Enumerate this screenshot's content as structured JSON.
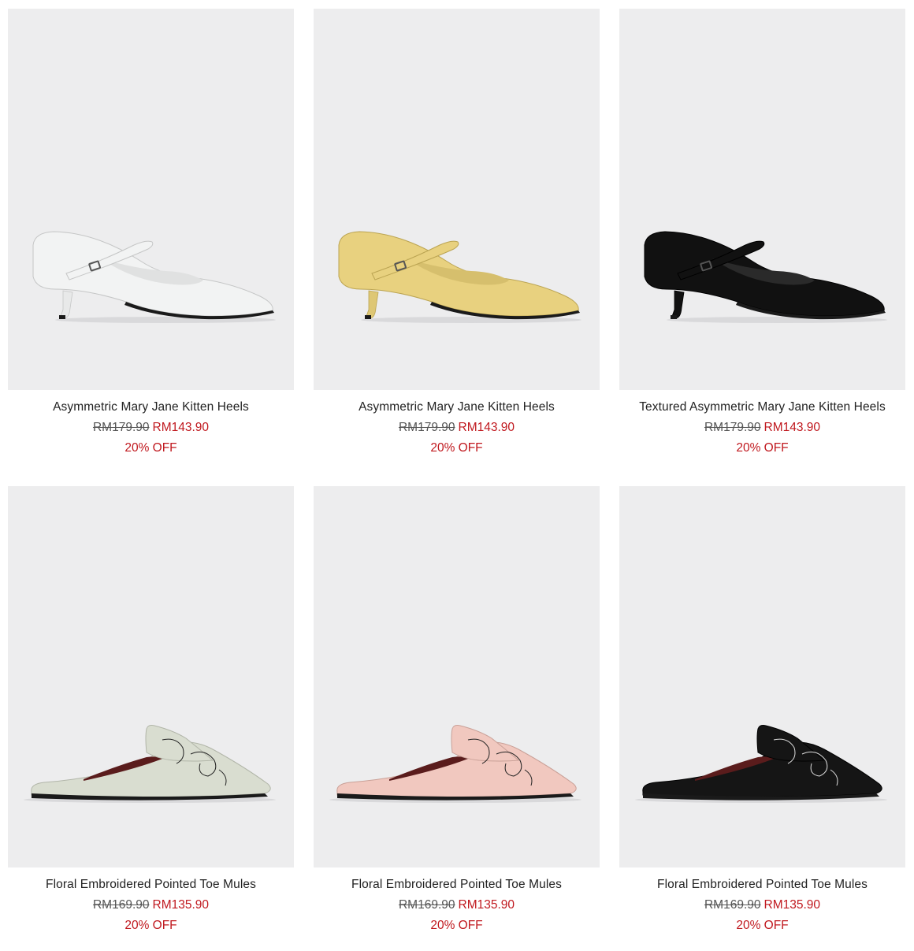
{
  "products": [
    {
      "name": "Asymmetric Mary Jane Kitten Heels",
      "original_price": "RM179.90",
      "sale_price": "RM143.90",
      "discount": "20% OFF",
      "image": "mary-jane-heel",
      "color": "#f2f3f3"
    },
    {
      "name": "Asymmetric Mary Jane Kitten Heels",
      "original_price": "RM179.90",
      "sale_price": "RM143.90",
      "discount": "20% OFF",
      "image": "mary-jane-heel",
      "color": "#e8d17f"
    },
    {
      "name": "Textured Asymmetric Mary Jane Kitten Heels",
      "original_price": "RM179.90",
      "sale_price": "RM143.90",
      "discount": "20% OFF",
      "image": "mary-jane-heel",
      "color": "#111111"
    },
    {
      "name": "Floral Embroidered Pointed Toe Mules",
      "original_price": "RM169.90",
      "sale_price": "RM135.90",
      "discount": "20% OFF",
      "image": "pointed-mule",
      "color": "#d9ddd0"
    },
    {
      "name": "Floral Embroidered Pointed Toe Mules",
      "original_price": "RM169.90",
      "sale_price": "RM135.90",
      "discount": "20% OFF",
      "image": "pointed-mule",
      "color": "#f1c8bf"
    },
    {
      "name": "Floral Embroidered Pointed Toe Mules",
      "original_price": "RM169.90",
      "sale_price": "RM135.90",
      "discount": "20% OFF",
      "image": "pointed-mule",
      "color": "#151515"
    }
  ],
  "theme": {
    "image_background": "#ededee",
    "sale_color": "#c0181e"
  }
}
